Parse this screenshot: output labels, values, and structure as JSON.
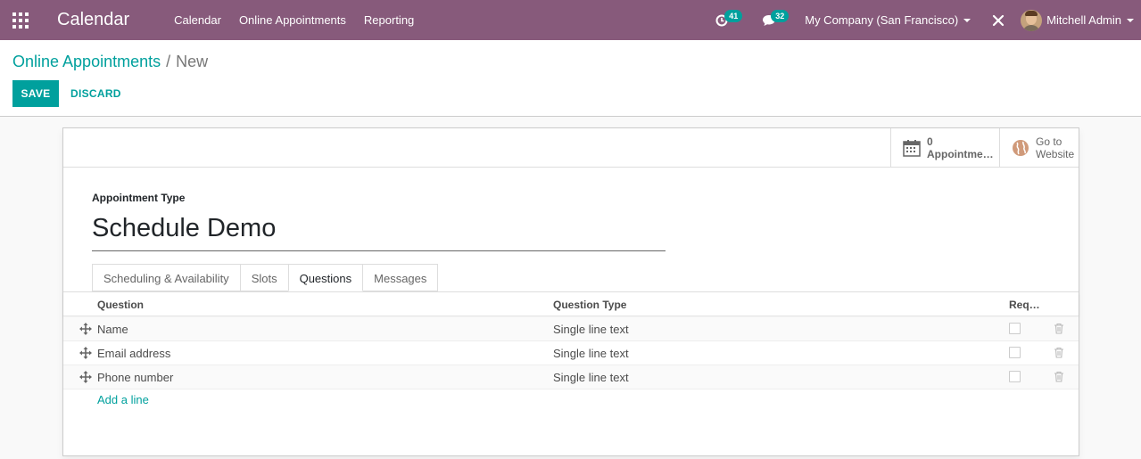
{
  "navbar": {
    "app_title": "Calendar",
    "menu": [
      "Calendar",
      "Online Appointments",
      "Reporting"
    ],
    "activity_count": "41",
    "message_count": "32",
    "company": "My Company (San Francisco)",
    "user": "Mitchell Admin",
    "color": "#875a7b"
  },
  "breadcrumb": {
    "parent": "Online Appointments",
    "separator": "/",
    "current": "New"
  },
  "actions": {
    "save": "SAVE",
    "discard": "DISCARD",
    "accent": "#00a09d"
  },
  "smart_buttons": {
    "appointments_value": "0",
    "appointments_label": "Appointme…",
    "website_line1": "Go to",
    "website_line2": "Website"
  },
  "form": {
    "field_label": "Appointment Type",
    "name_value": "Schedule Demo"
  },
  "tabs": [
    "Scheduling & Availability",
    "Slots",
    "Questions",
    "Messages"
  ],
  "active_tab": "Questions",
  "table": {
    "columns": [
      "Question",
      "Question Type",
      "Req…"
    ],
    "rows": [
      {
        "question": "Name",
        "type": "Single line text"
      },
      {
        "question": "Email address",
        "type": "Single line text"
      },
      {
        "question": "Phone number",
        "type": "Single line text"
      }
    ],
    "add_line": "Add a line"
  },
  "icons": {
    "apps": "grid-icon",
    "activity": "clock-icon",
    "messages": "chat-icon",
    "debug": "bug-icon",
    "calendar": "calendar-icon",
    "website": "globe-icon",
    "handle": "drag-handle-icon",
    "trash": "trash-icon"
  }
}
